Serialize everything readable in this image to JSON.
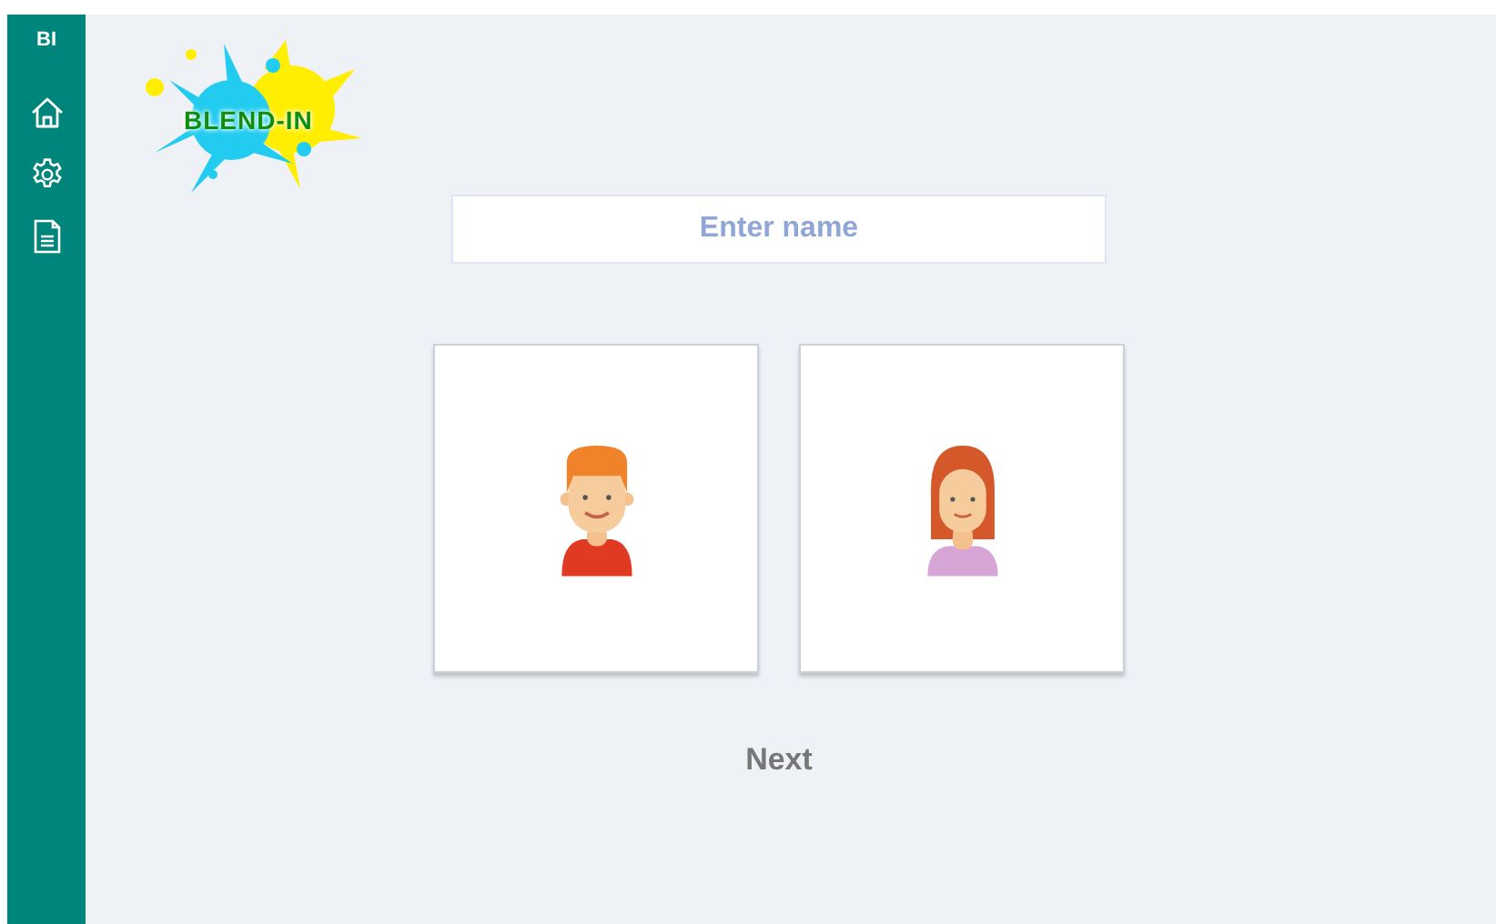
{
  "sidebar": {
    "badge": "BI",
    "items": [
      {
        "kind": "home"
      },
      {
        "kind": "settings"
      },
      {
        "kind": "document"
      }
    ]
  },
  "logo": {
    "text": "BLEND-IN"
  },
  "name_field": {
    "placeholder": "Enter name"
  },
  "avatars": [
    {
      "kind": "boy"
    },
    {
      "kind": "girl"
    }
  ],
  "next_button": {
    "label": "Next"
  }
}
